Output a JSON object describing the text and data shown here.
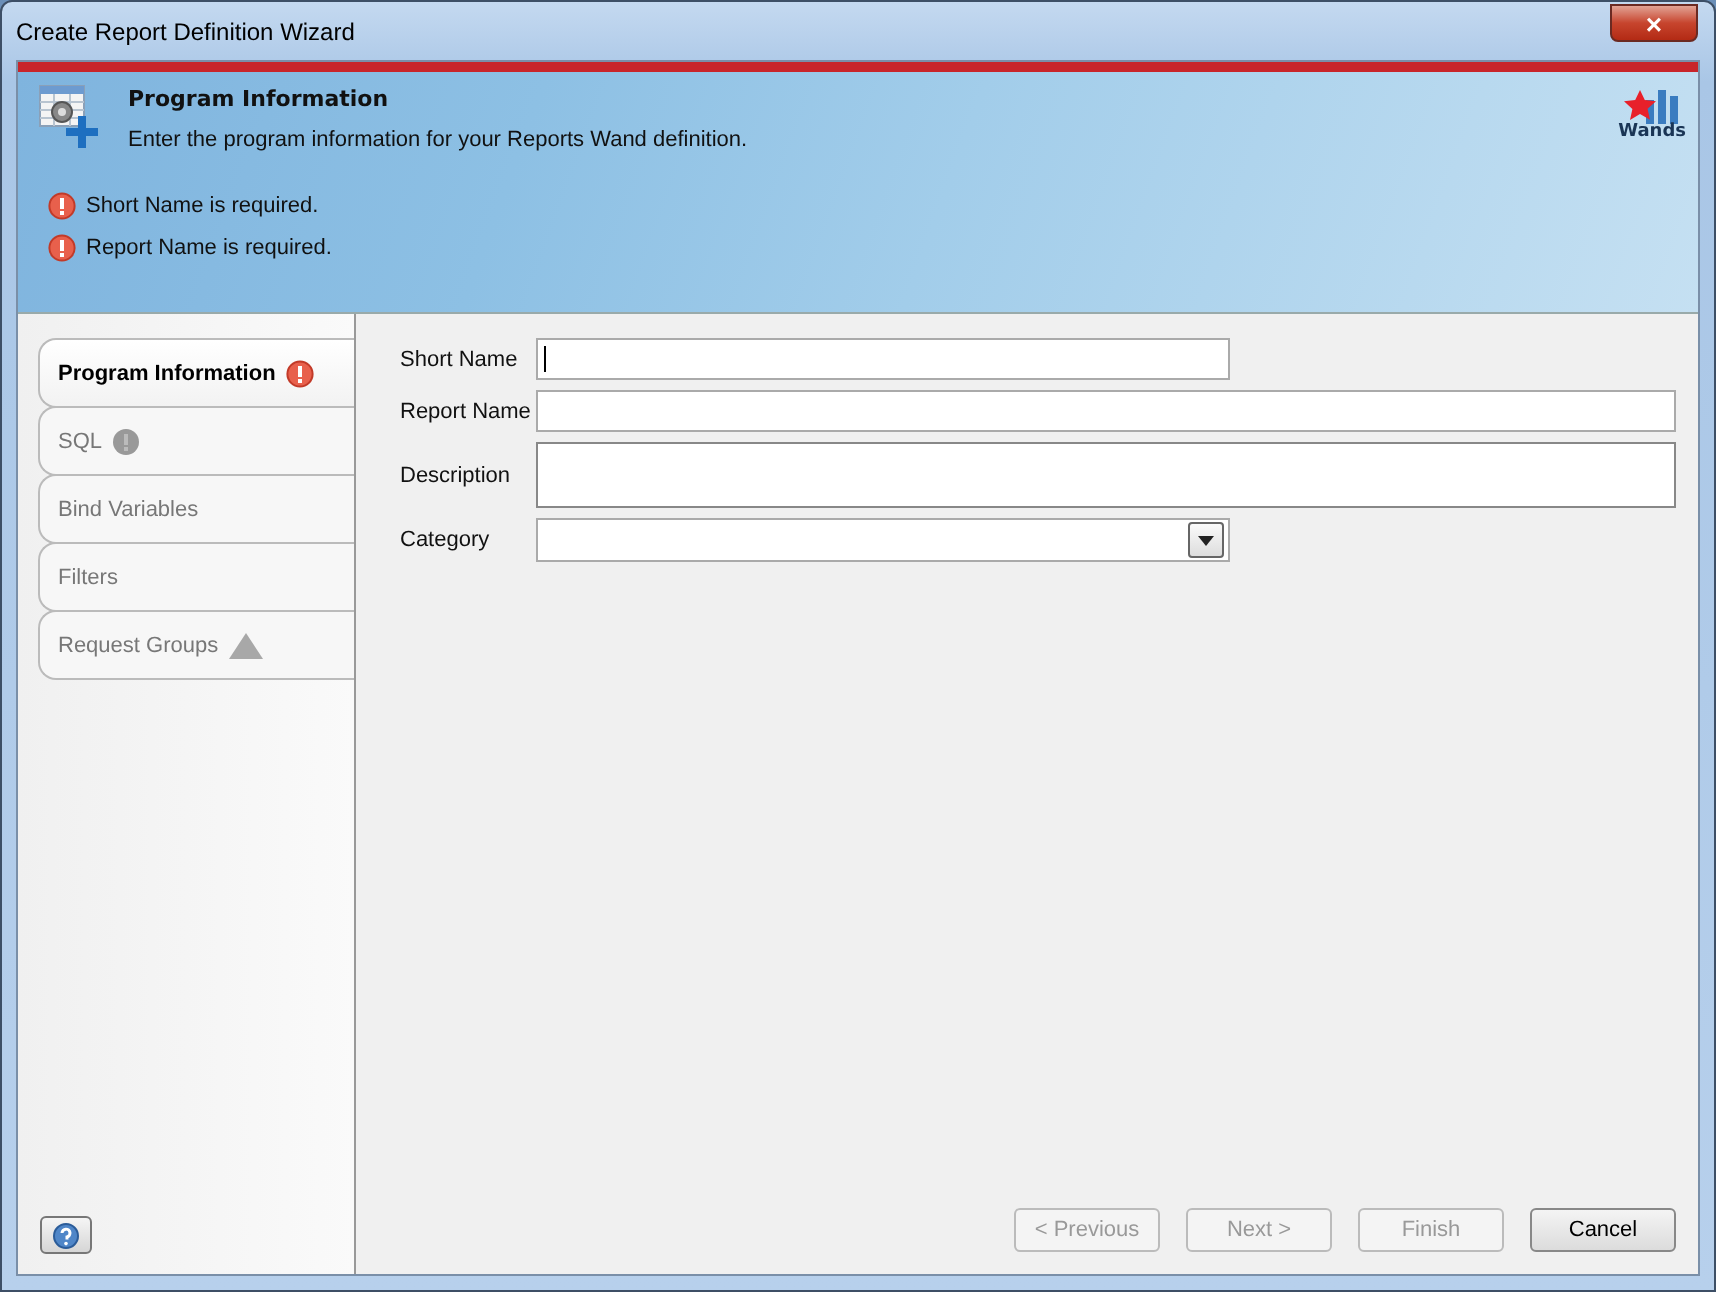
{
  "window": {
    "title": "Create Report Definition Wizard",
    "close": "×"
  },
  "header": {
    "title": "Program Information",
    "subtitle": "Enter the program information for your Reports Wand definition.",
    "logo_text": "Wands",
    "messages": [
      {
        "kind": "error",
        "text": "Short Name is required."
      },
      {
        "kind": "error",
        "text": "Report Name is required."
      }
    ]
  },
  "steps": [
    {
      "label": "Program Information",
      "selected": true,
      "kind": "error"
    },
    {
      "label": "SQL",
      "selected": false,
      "kind": "pending"
    },
    {
      "label": "Bind Variables",
      "selected": false,
      "kind": "plain"
    },
    {
      "label": "Filters",
      "selected": false,
      "kind": "plain"
    },
    {
      "label": "Request Groups",
      "selected": false,
      "kind": "warning"
    }
  ],
  "fields": [
    {
      "label": "Short Name",
      "kind": "text",
      "focused": true
    },
    {
      "label": "Report Name",
      "kind": "text",
      "focused": false
    },
    {
      "label": "Description",
      "kind": "textarea",
      "focused": false
    },
    {
      "label": "Category",
      "kind": "select",
      "focused": false
    }
  ],
  "buttons": [
    {
      "label": "< Previous",
      "disabled": true
    },
    {
      "label": "Next >",
      "disabled": true
    },
    {
      "label": "Finish",
      "disabled": true
    },
    {
      "label": "Cancel",
      "disabled": false
    }
  ]
}
